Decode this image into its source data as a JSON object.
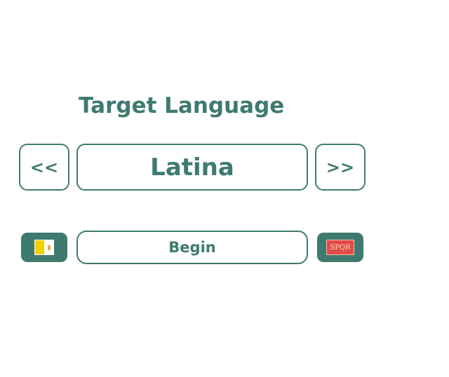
{
  "colors": {
    "accent": "#3f7a70",
    "background": "#ffffff",
    "vatican_yellow": "#f5d000",
    "spqr_red": "#e24a4a"
  },
  "header": {
    "title": "Target Language"
  },
  "selector": {
    "prev_label": "<<",
    "next_label": ">>",
    "current_language": "Latina"
  },
  "actions": {
    "begin_label": "Begin",
    "left_flag_icon": "vatican-flag-icon",
    "right_flag_icon": "spqr-flag-icon",
    "spqr_text": "SPQR"
  }
}
